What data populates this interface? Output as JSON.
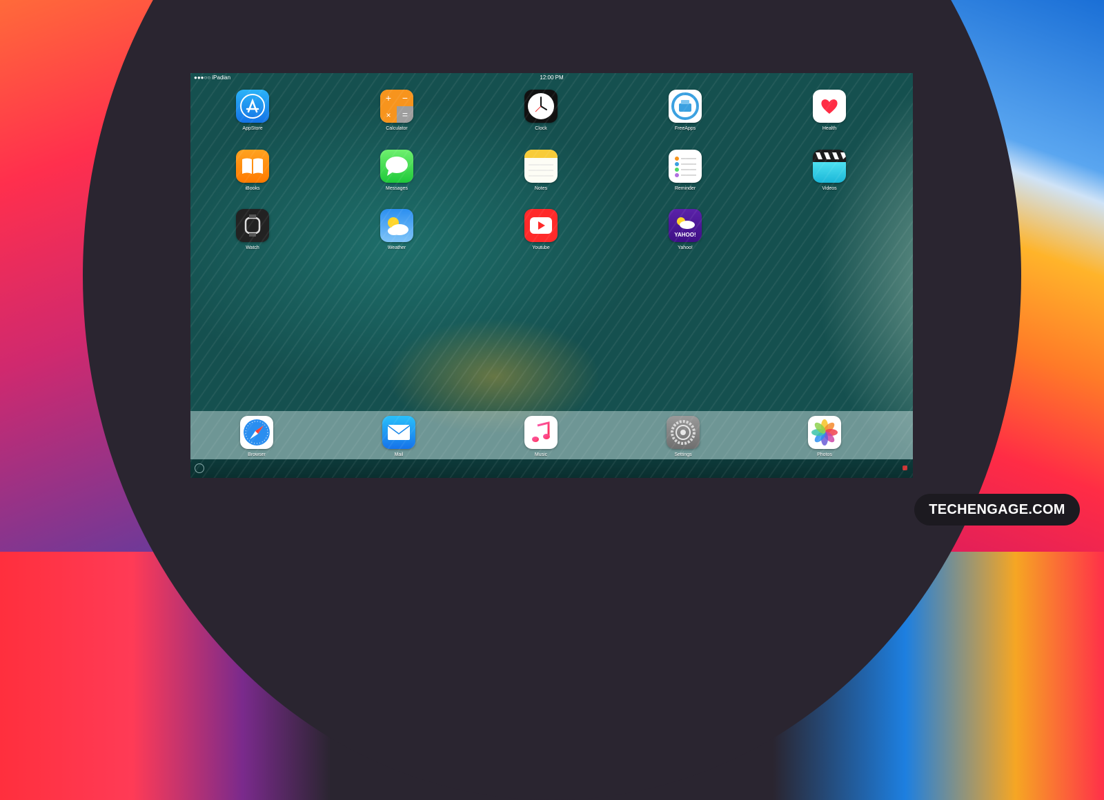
{
  "status": {
    "carrier": "●●●○○ iPadian",
    "time": "12:00 PM"
  },
  "apps": [
    {
      "id": "appstore",
      "label": "AppStore",
      "icon": "app-store-icon"
    },
    {
      "id": "calculator",
      "label": "Calculator",
      "icon": "calculator-icon"
    },
    {
      "id": "clock",
      "label": "Clock",
      "icon": "clock-icon"
    },
    {
      "id": "freeapps",
      "label": "FreeApps",
      "icon": "freeapps-icon"
    },
    {
      "id": "health",
      "label": "Health",
      "icon": "health-icon"
    },
    {
      "id": "ibooks",
      "label": "iBooks",
      "icon": "ibooks-icon"
    },
    {
      "id": "messages",
      "label": "Messages",
      "icon": "messages-icon"
    },
    {
      "id": "notes",
      "label": "Notes",
      "icon": "notes-icon"
    },
    {
      "id": "reminder",
      "label": "Reminder",
      "icon": "reminder-icon"
    },
    {
      "id": "videos",
      "label": "Videos",
      "icon": "videos-icon"
    },
    {
      "id": "watch",
      "label": "Watch",
      "icon": "watch-icon"
    },
    {
      "id": "weather",
      "label": "Weather",
      "icon": "weather-icon"
    },
    {
      "id": "youtube",
      "label": "Youtube",
      "icon": "youtube-icon"
    },
    {
      "id": "yahoo",
      "label": "Yahoo!",
      "icon": "yahoo-weather-icon",
      "icon_text": "YAHOO!"
    }
  ],
  "dock": [
    {
      "id": "browser",
      "label": "Browser",
      "icon": "safari-compass-icon"
    },
    {
      "id": "mail",
      "label": "Mail",
      "icon": "mail-icon"
    },
    {
      "id": "music",
      "label": "Music",
      "icon": "music-icon"
    },
    {
      "id": "settings",
      "label": "Settings",
      "icon": "settings-gear-icon"
    },
    {
      "id": "photos",
      "label": "Photos",
      "icon": "photos-icon"
    }
  ],
  "page_dots": {
    "count": 2,
    "active": 1
  },
  "watermark": "TECHENGAGE.COM"
}
